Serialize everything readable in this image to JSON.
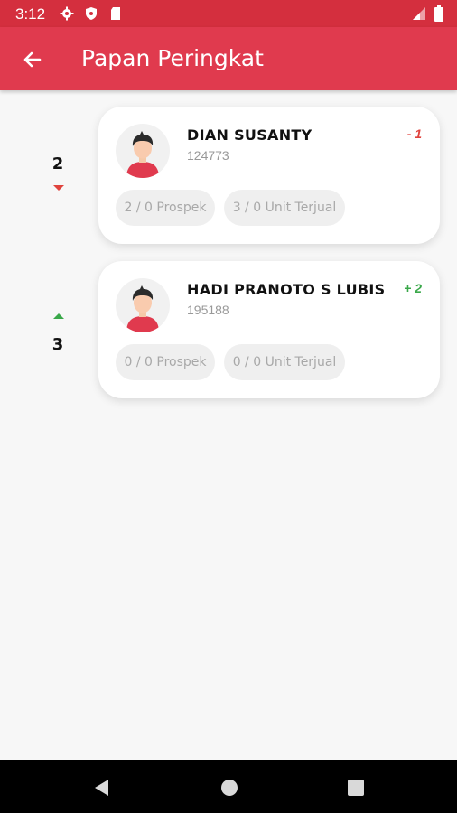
{
  "status_bar": {
    "time": "3:12",
    "icons": [
      "settings-gear-icon",
      "shield-icon",
      "sim-card-icon",
      "signal-icon",
      "battery-icon"
    ]
  },
  "app_bar": {
    "title": "Papan Peringkat",
    "back_icon": "arrow-left-icon",
    "color": "#e03a4e"
  },
  "leaderboard": [
    {
      "rank": "2",
      "trend": "down",
      "name": "DIAN SUSANTY",
      "code": "124773",
      "change": "- 1",
      "prospek": "2 / 0 Prospek",
      "unit_terjual": "3 / 0 Unit Terjual"
    },
    {
      "rank": "3",
      "trend": "up",
      "name": "HADI PRANOTO S LUBIS",
      "code": "195188",
      "change": "+ 2",
      "prospek": "0 / 0 Prospek",
      "unit_terjual": "0 / 0 Unit Terjual"
    }
  ],
  "colors": {
    "trend_down": "#e0433d",
    "trend_up": "#3aa84a"
  },
  "nav_bar": {
    "icons": [
      "back-triangle-icon",
      "home-circle-icon",
      "recents-square-icon"
    ]
  }
}
